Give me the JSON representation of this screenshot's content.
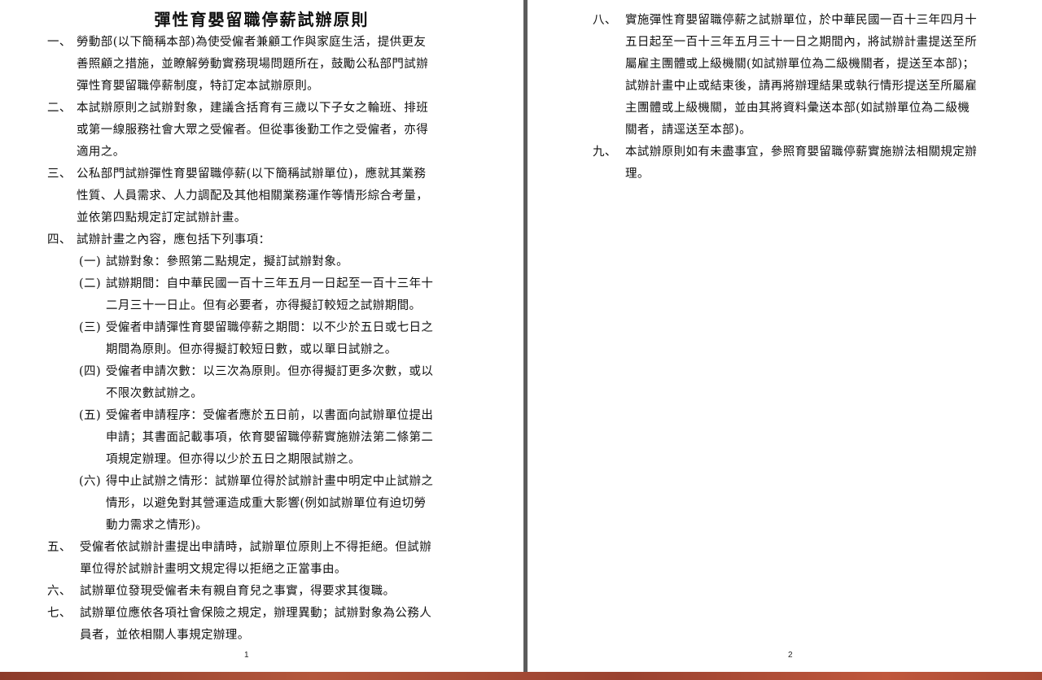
{
  "document": {
    "title": "彈性育嬰留職停薪試辦原則",
    "page1_number": "1",
    "page2_number": "2"
  },
  "page1": {
    "items": [
      {
        "label": "一、",
        "lines": [
          "勞動部(以下簡稱本部)為使受僱者兼顧工作與家庭生活，提供更友",
          "善照顧之措施，並瞭解勞動實務現場問題所在，鼓勵公私部門試辦",
          "彈性育嬰留職停薪制度，特訂定本試辦原則。"
        ]
      },
      {
        "label": "二、",
        "lines": [
          "本試辦原則之試辦對象，建議含括育有三歲以下子女之輪班、排班",
          "或第一線服務社會大眾之受僱者。但從事後勤工作之受僱者，亦得",
          "適用之。"
        ]
      },
      {
        "label": "三、",
        "lines": [
          "公私部門試辦彈性育嬰留職停薪(以下簡稱試辦單位)，應就其業務",
          "性質、人員需求、人力調配及其他相關業務運作等情形綜合考量，",
          "並依第四點規定訂定試辦計畫。"
        ]
      },
      {
        "label": "四、",
        "lines": [
          "試辦計畫之內容，應包括下列事項："
        ]
      }
    ],
    "subitems": [
      {
        "label": "(一)",
        "lines": [
          "試辦對象：參照第二點規定，擬訂試辦對象。"
        ]
      },
      {
        "label": "(二)",
        "lines": [
          "試辦期間：自中華民國一百十三年五月一日起至一百十三年十",
          "二月三十一日止。但有必要者，亦得擬訂較短之試辦期間。"
        ]
      },
      {
        "label": "(三)",
        "lines": [
          "受僱者申請彈性育嬰留職停薪之期間：以不少於五日或七日之",
          "期間為原則。但亦得擬訂較短日數，或以單日試辦之。"
        ]
      },
      {
        "label": "(四)",
        "lines": [
          "受僱者申請次數：以三次為原則。但亦得擬訂更多次數，或以",
          "不限次數試辦之。"
        ]
      },
      {
        "label": "(五)",
        "lines": [
          "受僱者申請程序：受僱者應於五日前，以書面向試辦單位提出",
          "申請；其書面記載事項，依育嬰留職停薪實施辦法第二條第二",
          "項規定辦理。但亦得以少於五日之期限試辦之。"
        ]
      },
      {
        "label": "(六)",
        "lines": [
          "得中止試辦之情形：試辦單位得於試辦計畫中明定中止試辦之",
          "情形，以避免對其營運造成重大影響(例如試辦單位有迫切勞",
          "動力需求之情形)。"
        ]
      }
    ],
    "tail_items": [
      {
        "label": "五、",
        "lines": [
          "受僱者依試辦計畫提出申請時，試辦單位原則上不得拒絕。但試辦",
          "單位得於試辦計畫明文規定得以拒絕之正當事由。"
        ]
      },
      {
        "label": "六、",
        "lines": [
          "試辦單位發現受僱者未有親自育兒之事實，得要求其復職。"
        ]
      },
      {
        "label": "七、",
        "lines": [
          "試辦單位應依各項社會保險之規定，辦理異動；試辦對象為公務人",
          "員者，並依相關人事規定辦理。"
        ]
      }
    ]
  },
  "page2": {
    "items": [
      {
        "label": "八、",
        "lines": [
          "實施彈性育嬰留職停薪之試辦單位，於中華民國一百十三年四月十",
          "五日起至一百十三年五月三十一日之期間內，將試辦計畫提送至所",
          "屬雇主團體或上級機關(如試辦單位為二級機關者，提送至本部)；",
          "試辦計畫中止或結束後，請再將辦理結果或執行情形提送至所屬雇",
          "主團體或上級機關，並由其將資料彙送本部(如試辦單位為二級機",
          "關者，請逕送至本部)。"
        ]
      },
      {
        "label": "九、",
        "lines": [
          "本試辦原則如有未盡事宜，參照育嬰留職停薪實施辦法相關規定辦",
          "理。"
        ]
      }
    ]
  }
}
